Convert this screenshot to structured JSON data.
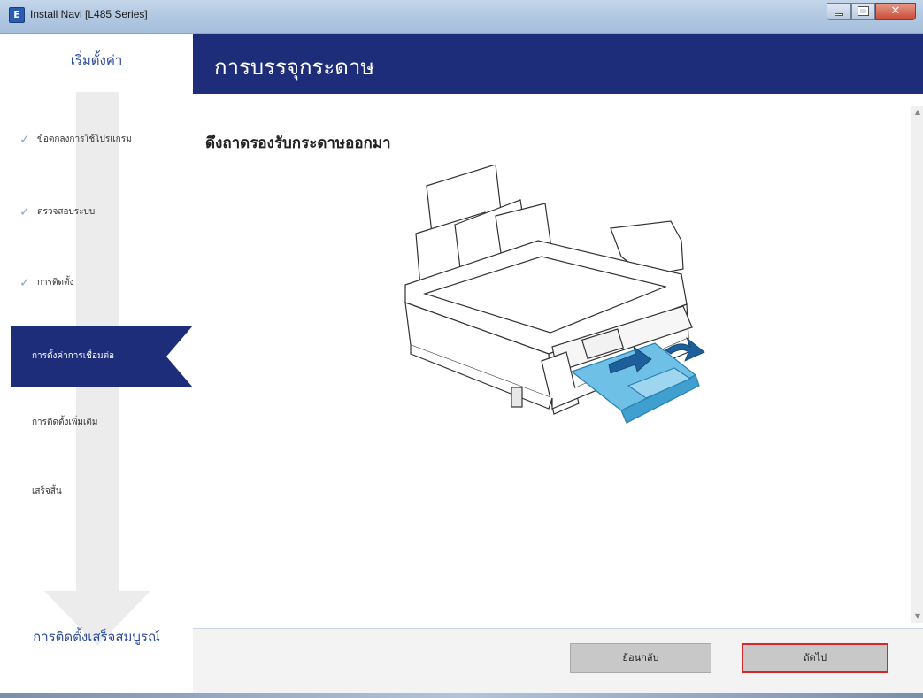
{
  "window": {
    "title": "Install Navi [L485 Series]",
    "icon_letter": "E"
  },
  "sidebar": {
    "header": "เริ่มตั้งค่า",
    "items": [
      {
        "label": "ข้อตกลงการใช้โปรแกรม",
        "state": "done"
      },
      {
        "label": "ตรวจสอบระบบ",
        "state": "done"
      },
      {
        "label": "การติดตั้ง",
        "state": "done"
      },
      {
        "label": "การตั้งค่าการเชื่อมต่อ",
        "state": "active"
      },
      {
        "label": "การติดตั้งเพิ่มเติม",
        "state": "pending"
      },
      {
        "label": "เสร็จสิ้น",
        "state": "pending"
      }
    ],
    "footer": "การติดตั้งเสร็จสมบูรณ์"
  },
  "main": {
    "title": "การบรรจุกระดาษ",
    "heading": "ดึงถาดรองรับกระดาษออกมา"
  },
  "buttons": {
    "back": "ย้อนกลับ",
    "next": "ถัดไป"
  },
  "colors": {
    "brand_navy": "#1e2d7a",
    "highlight_red": "#d62828",
    "tray_blue": "#5fb6e0"
  },
  "icons": {
    "check": "checkmark-icon",
    "scroll_up": "scroll-up-icon",
    "scroll_down": "scroll-down-icon"
  }
}
